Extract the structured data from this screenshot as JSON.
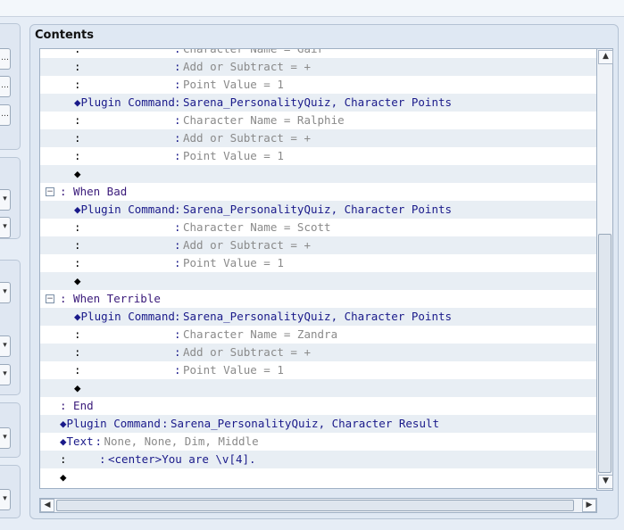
{
  "panel": {
    "title": "Contents"
  },
  "left_buttons": {
    "ellipsis": "…",
    "dropdown": "▾"
  },
  "scrollbars": {
    "up": "▲",
    "down": "▼",
    "left": "◀",
    "right": "▶"
  },
  "event_rows": [
    {
      "indent": 2,
      "label": ":",
      "sep": ":",
      "value": "Character Name = Gair",
      "kind": "param"
    },
    {
      "indent": 2,
      "label": ":",
      "sep": ":",
      "value": "Add or Subtract = +",
      "kind": "param"
    },
    {
      "indent": 2,
      "label": ":",
      "sep": ":",
      "value": "Point Value = 1",
      "kind": "param"
    },
    {
      "indent": 2,
      "label": "◆Plugin Command",
      "sep": ":",
      "value": "Sarena_PersonalityQuiz, Character Points",
      "kind": "command"
    },
    {
      "indent": 2,
      "label": ":",
      "sep": ":",
      "value": "Character Name = Ralphie",
      "kind": "param"
    },
    {
      "indent": 2,
      "label": ":",
      "sep": ":",
      "value": "Add or Subtract = +",
      "kind": "param"
    },
    {
      "indent": 2,
      "label": ":",
      "sep": ":",
      "value": "Point Value = 1",
      "kind": "param"
    },
    {
      "indent": 2,
      "label": "◆",
      "sep": "",
      "value": "",
      "kind": "empty"
    },
    {
      "indent": 1,
      "label": ": When Bad",
      "sep": "",
      "value": "",
      "kind": "branch",
      "fold": "−"
    },
    {
      "indent": 2,
      "label": "◆Plugin Command",
      "sep": ":",
      "value": "Sarena_PersonalityQuiz, Character Points",
      "kind": "command"
    },
    {
      "indent": 2,
      "label": ":",
      "sep": ":",
      "value": "Character Name = Scott",
      "kind": "param"
    },
    {
      "indent": 2,
      "label": ":",
      "sep": ":",
      "value": "Add or Subtract = +",
      "kind": "param"
    },
    {
      "indent": 2,
      "label": ":",
      "sep": ":",
      "value": "Point Value = 1",
      "kind": "param"
    },
    {
      "indent": 2,
      "label": "◆",
      "sep": "",
      "value": "",
      "kind": "empty"
    },
    {
      "indent": 1,
      "label": ": When Terrible",
      "sep": "",
      "value": "",
      "kind": "branch",
      "fold": "−"
    },
    {
      "indent": 2,
      "label": "◆Plugin Command",
      "sep": ":",
      "value": "Sarena_PersonalityQuiz, Character Points",
      "kind": "command"
    },
    {
      "indent": 2,
      "label": ":",
      "sep": ":",
      "value": "Character Name = Zandra",
      "kind": "param"
    },
    {
      "indent": 2,
      "label": ":",
      "sep": ":",
      "value": "Add or Subtract = +",
      "kind": "param"
    },
    {
      "indent": 2,
      "label": ":",
      "sep": ":",
      "value": "Point Value = 1",
      "kind": "param"
    },
    {
      "indent": 2,
      "label": "◆",
      "sep": "",
      "value": "",
      "kind": "empty"
    },
    {
      "indent": 1,
      "label": ": End",
      "sep": "",
      "value": "",
      "kind": "branch_end"
    },
    {
      "indent": 0,
      "label": "◆Plugin Command",
      "sep": ":",
      "value": "Sarena_PersonalityQuiz, Character Result",
      "kind": "command"
    },
    {
      "indent": 0,
      "label": "◆Text",
      "sep": ":",
      "value": "None, None, Dim, Middle",
      "kind": "text_cmd"
    },
    {
      "indent": 0,
      "label": ":",
      "sep": ":",
      "value": "<center>You are \\v[4].",
      "kind": "text_body"
    },
    {
      "indent": 0,
      "label": "◆",
      "sep": "",
      "value": "",
      "kind": "empty"
    }
  ]
}
